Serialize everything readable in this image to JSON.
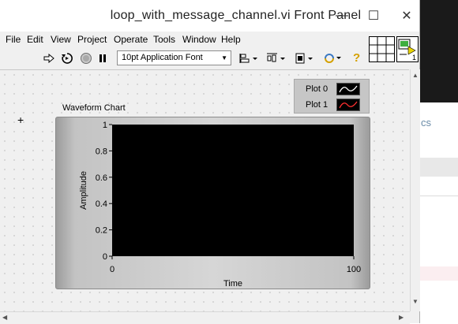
{
  "window": {
    "title": "loop_with_message_channel.vi Front Panel",
    "minimize_glyph": "—",
    "maximize_glyph": "☐",
    "close_glyph": "✕"
  },
  "menu": [
    "File",
    "Edit",
    "View",
    "Project",
    "Operate",
    "Tools",
    "Window",
    "Help"
  ],
  "toolbar": {
    "font_value": "10pt Application Font",
    "icons": [
      "run-arrow-icon",
      "run-continuously-icon",
      "abort-icon",
      "pause-icon",
      "align-objects-icon",
      "distribute-objects-icon",
      "resize-objects-icon",
      "reorder-icon",
      "context-help-icon"
    ],
    "help_glyph": "?"
  },
  "vi_icon": {
    "badge": "1"
  },
  "legend": {
    "plots": [
      {
        "name": "Plot 0",
        "color": "#ffffff"
      },
      {
        "name": "Plot 1",
        "color": "#ff3030"
      }
    ]
  },
  "chart": {
    "label": "Waveform Chart"
  },
  "chart_data": {
    "type": "line",
    "title": "Waveform Chart",
    "xlabel": "Time",
    "ylabel": "Amplitude",
    "xlim": [
      0,
      100
    ],
    "ylim": [
      0,
      1
    ],
    "x_ticks": [
      "0",
      "100"
    ],
    "y_ticks": [
      "0",
      "0.2",
      "0.4",
      "0.6",
      "0.8",
      "1"
    ],
    "plot_background": "#000000",
    "grid": false,
    "series": [
      {
        "name": "Plot 0",
        "values": [],
        "color": "#ffffff"
      },
      {
        "name": "Plot 1",
        "values": [],
        "color": "#ff3030"
      }
    ]
  },
  "background_app": {
    "partial_text": "cs"
  }
}
